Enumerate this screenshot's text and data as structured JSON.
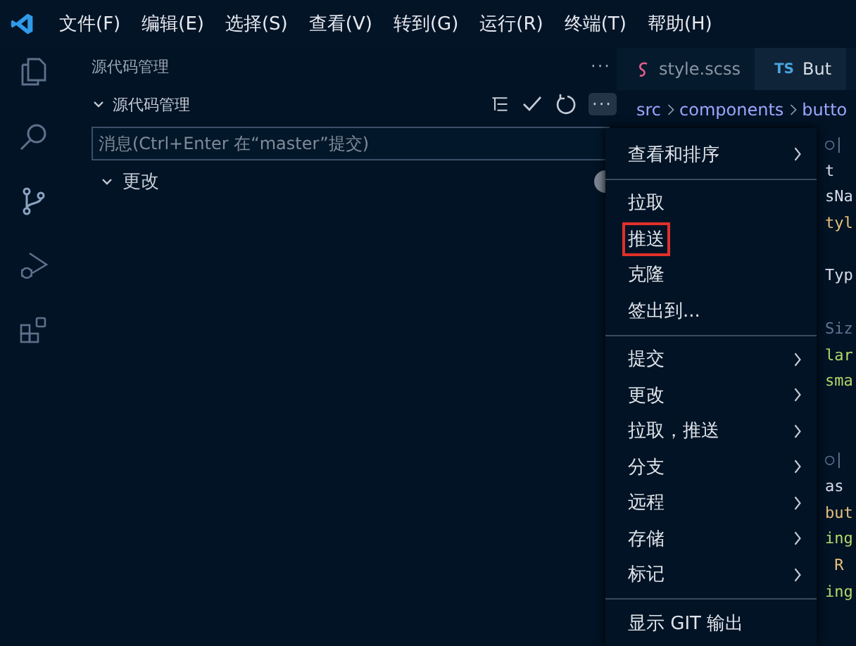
{
  "menu_bar": [
    "文件(F)",
    "编辑(E)",
    "选择(S)",
    "查看(V)",
    "转到(G)",
    "运行(R)",
    "终端(T)",
    "帮助(H)"
  ],
  "activity_bar": [
    {
      "kind": "files",
      "selected": false
    },
    {
      "kind": "search",
      "selected": false
    },
    {
      "kind": "source-control",
      "selected": true
    },
    {
      "kind": "run-debug",
      "selected": false
    },
    {
      "kind": "extensions",
      "selected": false
    }
  ],
  "sidebar": {
    "title": "源代码管理",
    "more": "···",
    "section": {
      "title": "源代码管理",
      "more_pressed": true,
      "more": "···"
    },
    "message": {
      "placeholder": "消息(Ctrl+Enter 在“master”提交)"
    },
    "changes": {
      "label": "更改",
      "expanded": true
    }
  },
  "editor": {
    "tabs": [
      {
        "kind": "scss",
        "label": "style.scss",
        "selected": false
      },
      {
        "kind": "ts",
        "badge": "TS",
        "label": "But",
        "selected": true
      }
    ],
    "breadcrumb": [
      "src",
      "components",
      "butto"
    ],
    "code_lines": [
      {
        "kind": "comment",
        "text": "○|"
      },
      {
        "kind": "plain",
        "text": "t"
      },
      {
        "kind": "plain",
        "text": "sNa"
      },
      {
        "kind": "type",
        "text": "tyl"
      },
      {
        "kind": "blank"
      },
      {
        "kind": "plain",
        "text": "Typ"
      },
      {
        "kind": "blank"
      },
      {
        "kind": "comment",
        "text": "Siz"
      },
      {
        "kind": "string",
        "text": "lar"
      },
      {
        "kind": "string",
        "text": "sma"
      },
      {
        "kind": "blank"
      },
      {
        "kind": "blank"
      },
      {
        "kind": "comment",
        "text": "○|"
      },
      {
        "kind": "plain",
        "text": "as"
      },
      {
        "kind": "type",
        "text": "but"
      },
      {
        "kind": "string",
        "text": "ing"
      },
      {
        "kind": "type",
        "text": " R"
      },
      {
        "kind": "string",
        "text": "ing"
      }
    ]
  },
  "context_menu": [
    {
      "kind": "item",
      "label": "查看和排序",
      "submenu": true,
      "outlined": false
    },
    {
      "kind": "separator"
    },
    {
      "kind": "item",
      "label": "拉取",
      "submenu": false,
      "outlined": false
    },
    {
      "kind": "item",
      "label": "推送",
      "submenu": false,
      "outlined": true
    },
    {
      "kind": "item",
      "label": "克隆",
      "submenu": false,
      "outlined": false
    },
    {
      "kind": "item",
      "label": "签出到...",
      "submenu": false,
      "outlined": false
    },
    {
      "kind": "separator"
    },
    {
      "kind": "item",
      "label": "提交",
      "submenu": true,
      "outlined": false
    },
    {
      "kind": "item",
      "label": "更改",
      "submenu": true,
      "outlined": false
    },
    {
      "kind": "item",
      "label": "拉取，推送",
      "submenu": true,
      "outlined": false
    },
    {
      "kind": "item",
      "label": "分支",
      "submenu": true,
      "outlined": false
    },
    {
      "kind": "item",
      "label": "远程",
      "submenu": true,
      "outlined": false
    },
    {
      "kind": "item",
      "label": "存储",
      "submenu": true,
      "outlined": false
    },
    {
      "kind": "item",
      "label": "标记",
      "submenu": true,
      "outlined": false
    },
    {
      "kind": "separator"
    },
    {
      "kind": "item",
      "label": "显示 GIT 输出",
      "submenu": false,
      "outlined": false
    }
  ]
}
